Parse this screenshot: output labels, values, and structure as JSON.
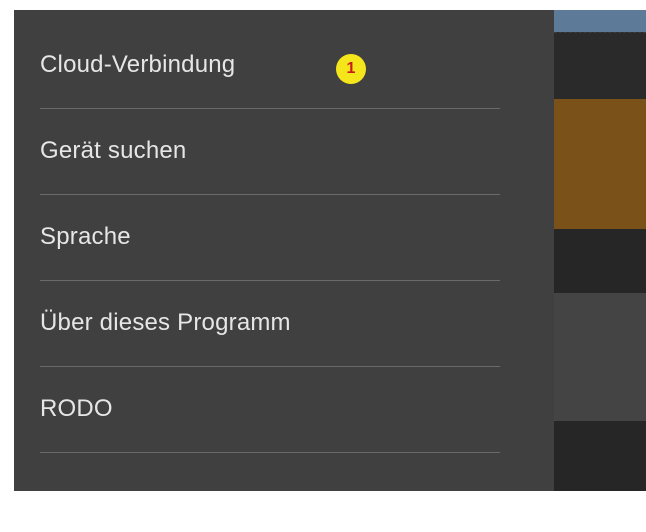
{
  "drawer": {
    "items": [
      {
        "label": "Cloud-Verbindung",
        "badge": "1"
      },
      {
        "label": "Gerät suchen"
      },
      {
        "label": "Sprache"
      },
      {
        "label": "Über dieses Programm"
      },
      {
        "label": "RODO"
      }
    ]
  },
  "colors": {
    "drawer_background": "#404040",
    "badge_fill": "#f5e51b",
    "badge_text": "#cc1a1a",
    "background_accent": "#7a5219"
  }
}
